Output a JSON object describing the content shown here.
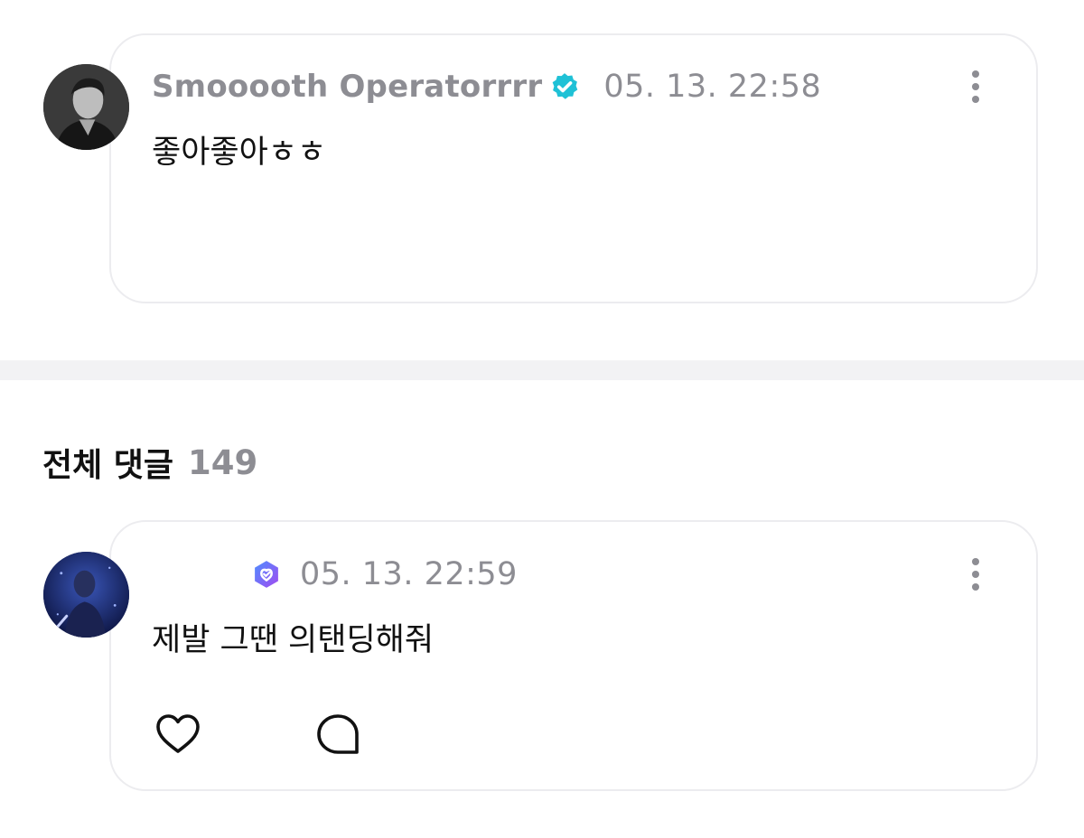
{
  "pinned_comment": {
    "username": "Smooooth Operatorrrr",
    "badge_icon": "verified-check-icon",
    "badge_color": "#1fc1d6",
    "timestamp": "05. 13. 22:58",
    "text": "좋아좋아ㅎㅎ",
    "more_icon": "vertical-ellipsis-icon"
  },
  "comments_section": {
    "title": "전체 댓글",
    "count": "149"
  },
  "comments": [
    {
      "username": "",
      "badge_icon": "fan-membership-badge-icon",
      "badge_color": "#7b5cf0",
      "timestamp": "05. 13. 22:59",
      "text": "제발 그땐 의탠딩해줘",
      "more_icon": "vertical-ellipsis-icon",
      "actions": {
        "like_icon": "heart-outline-icon",
        "reply_icon": "speech-bubble-icon"
      }
    }
  ],
  "colors": {
    "muted_text": "#8d8d93",
    "card_border": "#ececef",
    "divider": "#f2f2f4",
    "primary_text": "#111111"
  }
}
